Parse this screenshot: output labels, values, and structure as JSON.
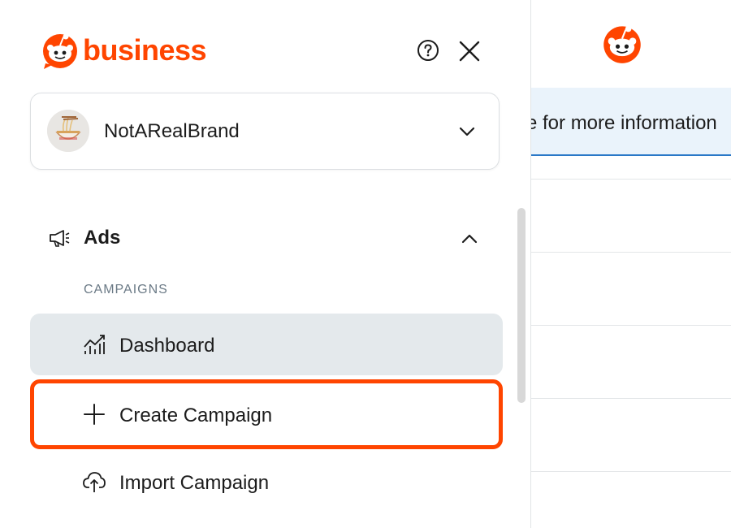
{
  "brand": {
    "name": "business",
    "accent": "#ff4500"
  },
  "header": {
    "help_icon": "help-circle-icon",
    "close_icon": "close-icon"
  },
  "account": {
    "name": "NotARealBrand",
    "avatar_icon": "ramen-bowl-avatar"
  },
  "nav": {
    "section": {
      "label": "Ads",
      "icon": "megaphone-icon",
      "expanded": true
    },
    "group_label": "CAMPAIGNS",
    "items": [
      {
        "label": "Dashboard",
        "icon": "chart-icon",
        "active": true
      },
      {
        "label": "Create Campaign",
        "icon": "plus-icon",
        "highlighted": true
      },
      {
        "label": "Import Campaign",
        "icon": "cloud-upload-icon"
      }
    ]
  },
  "background": {
    "banner_text": "e for more information"
  },
  "colors": {
    "active_bg": "#e4e9ec",
    "highlight_border": "#ff4500",
    "banner_bg": "#eaf3fb"
  }
}
